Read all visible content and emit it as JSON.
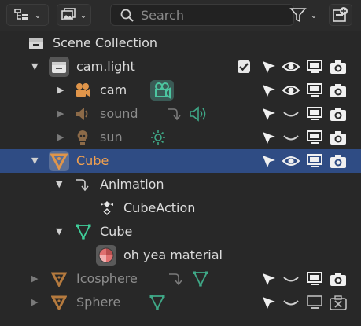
{
  "search": {
    "placeholder": "Search"
  },
  "rows": [
    {
      "label": "Scene Collection"
    },
    {
      "label": "cam.light"
    },
    {
      "label": "cam"
    },
    {
      "label": "sound"
    },
    {
      "label": "sun"
    },
    {
      "label": "Cube"
    },
    {
      "label": "Animation"
    },
    {
      "label": "CubeAction"
    },
    {
      "label": "Cube"
    },
    {
      "label": "oh yea material"
    },
    {
      "label": "Icosphere"
    },
    {
      "label": "Sphere"
    }
  ],
  "colors": {
    "background": "#282828",
    "selected_row": "#2f4c84",
    "object_orange": "#e0954a",
    "data_green": "#4cc5a0",
    "mesh_green": "#3fcf9a",
    "dim_text": "#8d8d8d"
  }
}
